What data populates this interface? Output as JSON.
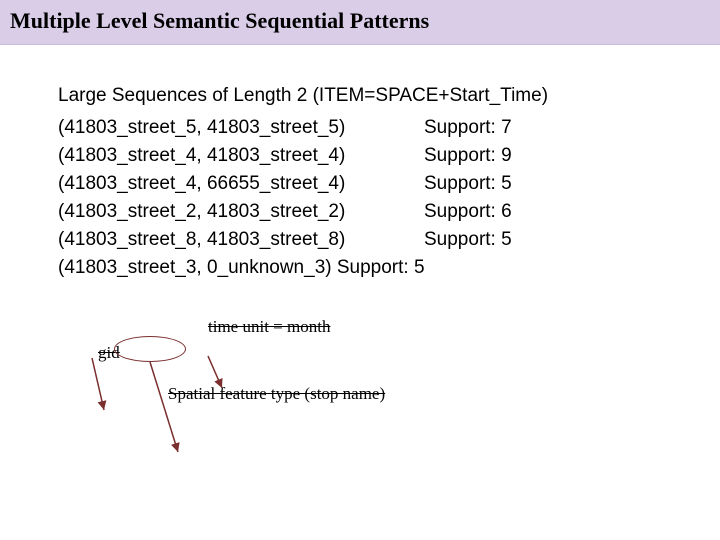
{
  "title": "Multiple Level Semantic Sequential Patterns",
  "heading": "Large Sequences of Length 2 (ITEM=SPACE+Start_Time)",
  "sequences": [
    {
      "pattern": "(41803_street_5, 41803_street_5)",
      "support": "Support: 7"
    },
    {
      "pattern": "(41803_street_4, 41803_street_4)",
      "support": "Support: 9"
    },
    {
      "pattern": "(41803_street_4, 66655_street_4)",
      "support": "Support: 5"
    },
    {
      "pattern": "(41803_street_2, 41803_street_2)",
      "support": "Support: 6"
    },
    {
      "pattern": "(41803_street_8, 41803_street_8)",
      "support": "Support: 5"
    }
  ],
  "last_sequence": "(41803_street_3, 0_unknown_3)   Support: 5",
  "annotations": {
    "time_unit": "time unit = month",
    "gid": "gid",
    "spatial_feature": "Spatial feature type (stop name)"
  }
}
